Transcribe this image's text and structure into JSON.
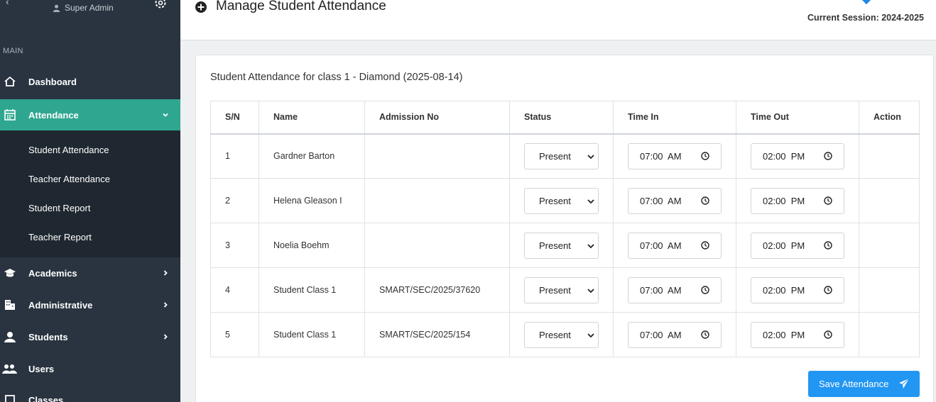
{
  "sidebar": {
    "user_role": "Super Admin",
    "section_main": "MAIN",
    "items": [
      {
        "label": "Dashboard",
        "icon": "home-icon"
      },
      {
        "label": "Attendance",
        "icon": "calendar-icon"
      },
      {
        "label": "Academics",
        "icon": "graduation-cap-icon"
      },
      {
        "label": "Administrative",
        "icon": "building-icon"
      },
      {
        "label": "Students",
        "icon": "student-icon"
      },
      {
        "label": "Users",
        "icon": "users-icon"
      },
      {
        "label": "Classes",
        "icon": "classes-icon"
      }
    ],
    "attendance_sub": [
      {
        "label": "Student Attendance"
      },
      {
        "label": "Teacher Attendance"
      },
      {
        "label": "Student Report"
      },
      {
        "label": "Teacher Report"
      }
    ],
    "active_color": "#2fa790"
  },
  "header": {
    "title": "Manage Student Attendance",
    "session": "Current Session: 2024-2025"
  },
  "card": {
    "title": "Student Attendance for class 1 - Diamond (2025-08-14)",
    "columns": [
      "S/N",
      "Name",
      "Admission No",
      "Status",
      "Time In",
      "Time Out",
      "Action"
    ],
    "rows": [
      {
        "sn": "1",
        "name": "Gardner Barton",
        "admission": "",
        "status": "Present",
        "time_in": "07:00  AM",
        "time_out": "02:00  PM"
      },
      {
        "sn": "2",
        "name": "Helena Gleason I",
        "admission": "",
        "status": "Present",
        "time_in": "07:00  AM",
        "time_out": "02:00  PM"
      },
      {
        "sn": "3",
        "name": "Noelia Boehm",
        "admission": "",
        "status": "Present",
        "time_in": "07:00  AM",
        "time_out": "02:00  PM"
      },
      {
        "sn": "4",
        "name": "Student Class 1",
        "admission": "SMART/SEC/2025/37620",
        "status": "Present",
        "time_in": "07:00  AM",
        "time_out": "02:00  PM"
      },
      {
        "sn": "5",
        "name": "Student Class 1",
        "admission": "SMART/SEC/2025/154",
        "status": "Present",
        "time_in": "07:00  AM",
        "time_out": "02:00  PM"
      }
    ],
    "save_label": "Save Attendance",
    "save_color": "#2196f3"
  }
}
